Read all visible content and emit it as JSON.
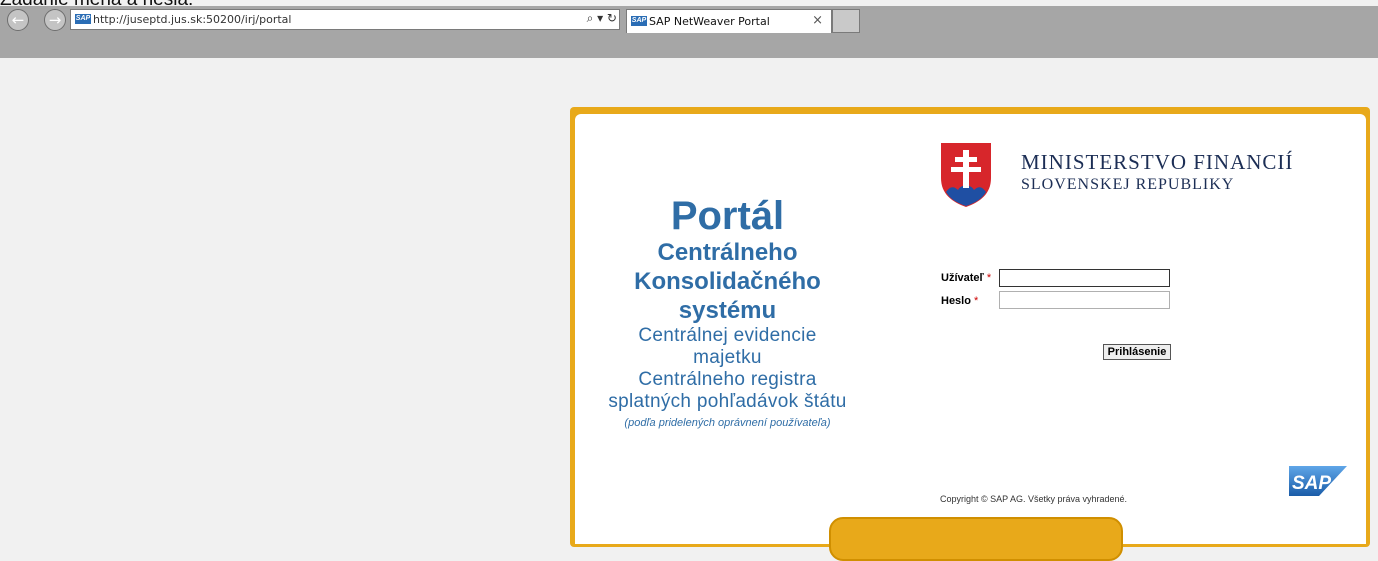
{
  "caption": "Zadanie mena a hesla:",
  "browser": {
    "back_icon": "arrow-left-icon",
    "forward_icon": "arrow-right-icon",
    "url": "http://juseptd.jus.sk:50200/irj/portal",
    "address_icons": "⌕ ▾ ↻",
    "tab_title": "SAP NetWeaver Portal",
    "tab_close": "×",
    "favicon_text": "SAP"
  },
  "portal": {
    "title_line1": "Portál",
    "title_line2": "Centrálneho",
    "title_line3": "Konsolidačného",
    "title_line4": "systému",
    "sub_line1": "Centrálnej evidencie",
    "sub_line2": "majetku",
    "sub_line3": "Centrálneho registra",
    "sub_line4": "splatných pohľadávok štátu",
    "note": "(podľa pridelených oprávnení používateľa)"
  },
  "ministry": {
    "line1": "MINISTERSTVO FINANCIÍ",
    "line2": "SLOVENSKEJ REPUBLIKY"
  },
  "login": {
    "user_label": "Užívateľ",
    "password_label": "Heslo",
    "required_mark": "*",
    "user_value": "",
    "password_value": "",
    "submit_label": "Prihlásenie"
  },
  "footer": {
    "copyright": "Copyright © SAP AG. Všetky práva vyhradené.",
    "logo_text": "SAP"
  },
  "colors": {
    "frame": "#e8a91a",
    "title_blue": "#2f6da6",
    "ministry_navy": "#1c2e55",
    "crest_red": "#d7262b",
    "crest_blue": "#1f4fa3"
  }
}
